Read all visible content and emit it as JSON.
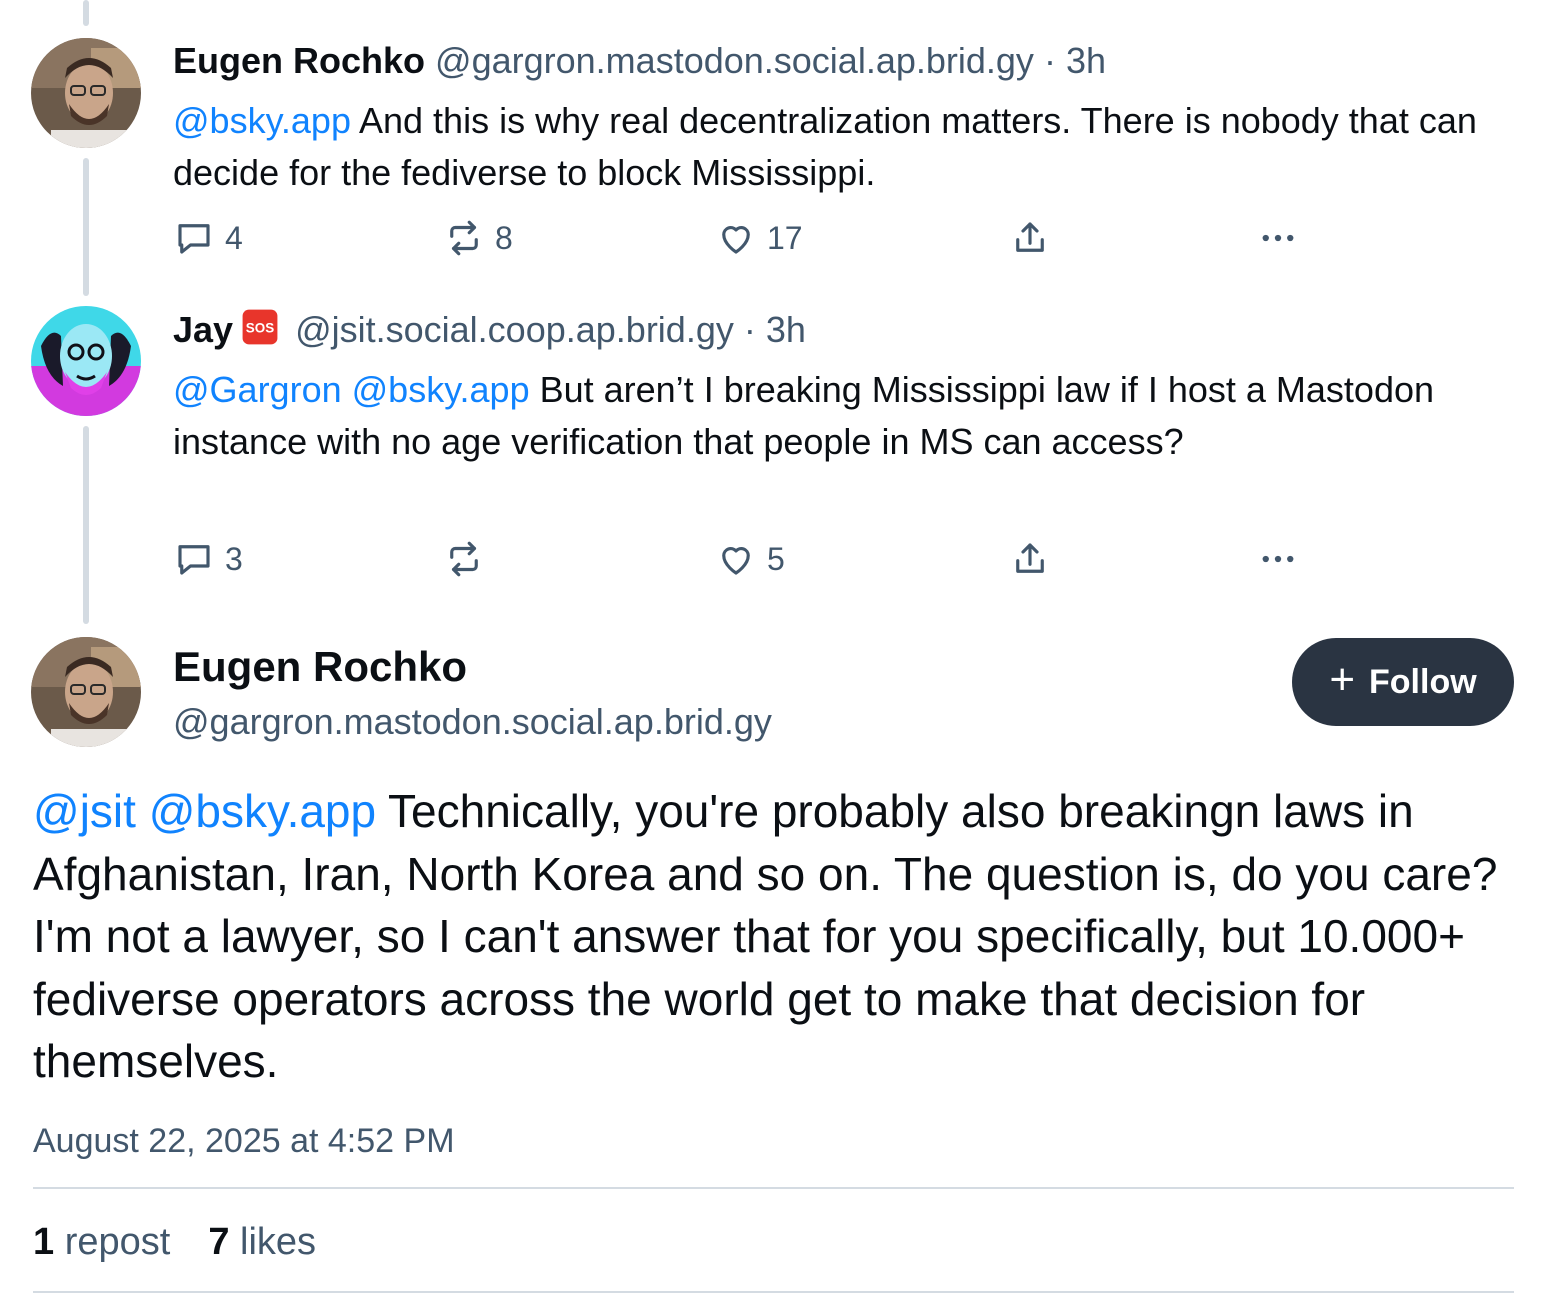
{
  "reply1": {
    "author_name": "Eugen Rochko",
    "handle": "@gargron.mastodon.social.ap.brid.gy",
    "separator": "·",
    "time": "3h",
    "mention1": "@bsky.app",
    "text": " And this is why real decentralization matters. There is nobody that can decide for the fediverse to block Mississippi.",
    "reply_count": "4",
    "repost_count": "8",
    "like_count": "17"
  },
  "reply2": {
    "author_name": "Jay",
    "name_emoji": "sos-emoji",
    "handle": "@jsit.social.coop.ap.brid.gy",
    "separator": "·",
    "time": "3h",
    "mention1": "@Gargron",
    "mention2": "@bsky.app",
    "text": " But aren’t I breaking Mississippi law if I host a Mastodon instance with no age verification that people in MS can access?",
    "reply_count": "3",
    "repost_count": "",
    "like_count": "5"
  },
  "main_post": {
    "author_name": "Eugen Rochko",
    "handle": "@gargron.mastodon.social.ap.brid.gy",
    "follow_plus": "+",
    "follow_label": "Follow",
    "mention1": "@jsit",
    "mention2": "@bsky.app",
    "text": " Technically, you're probably also breakingn laws in Afghanistan, Iran, North Korea and so on. The question is, do you care? I'm not a lawyer, so I can't answer that for you specifically, but 10.000+ fediverse operators across the world get to make that decision for themselves.",
    "timestamp": "August 22, 2025 at 4:52 PM",
    "repost_count": "1",
    "repost_label": "repost",
    "like_count": "7",
    "like_label": "likes"
  },
  "colors": {
    "mention": "#1083fe",
    "muted": "#42576c",
    "follow_button": "#2a3442",
    "thread_line": "#d4dbe2"
  },
  "icons": [
    "reply-icon",
    "repost-icon",
    "like-icon",
    "share-icon",
    "more-icon",
    "plus-icon",
    "sos-emoji"
  ]
}
